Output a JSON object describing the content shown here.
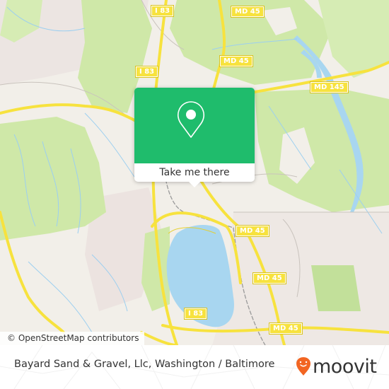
{
  "map": {
    "attribution": "© OpenStreetMap contributors",
    "road_labels": [
      {
        "id": "i83-top",
        "text": "I 83"
      },
      {
        "id": "md45-top",
        "text": "MD 45"
      },
      {
        "id": "i83-mid",
        "text": "I 83"
      },
      {
        "id": "md45-mid",
        "text": "MD 45"
      },
      {
        "id": "md145",
        "text": "MD 145"
      },
      {
        "id": "md45-east",
        "text": "MD 45"
      },
      {
        "id": "md45-south",
        "text": "MD 45"
      },
      {
        "id": "i83-south",
        "text": "I 83"
      },
      {
        "id": "md45-bottom",
        "text": "MD 45"
      }
    ],
    "colors": {
      "land": "#f2efe9",
      "forest": "#cfe8a8",
      "water": "#a8d6f0",
      "road": "#f7e23e",
      "urban": "#ece3e0"
    }
  },
  "popup": {
    "icon": "map-pin-icon",
    "button_label": "Take me there",
    "accent_color": "#1fbc6c"
  },
  "footer": {
    "title": "Bayard Sand & Gravel, Llc, Washington / Baltimore",
    "brand": "moovit",
    "brand_icon": "moovit-pin-logo-icon",
    "brand_color": "#f26522"
  }
}
